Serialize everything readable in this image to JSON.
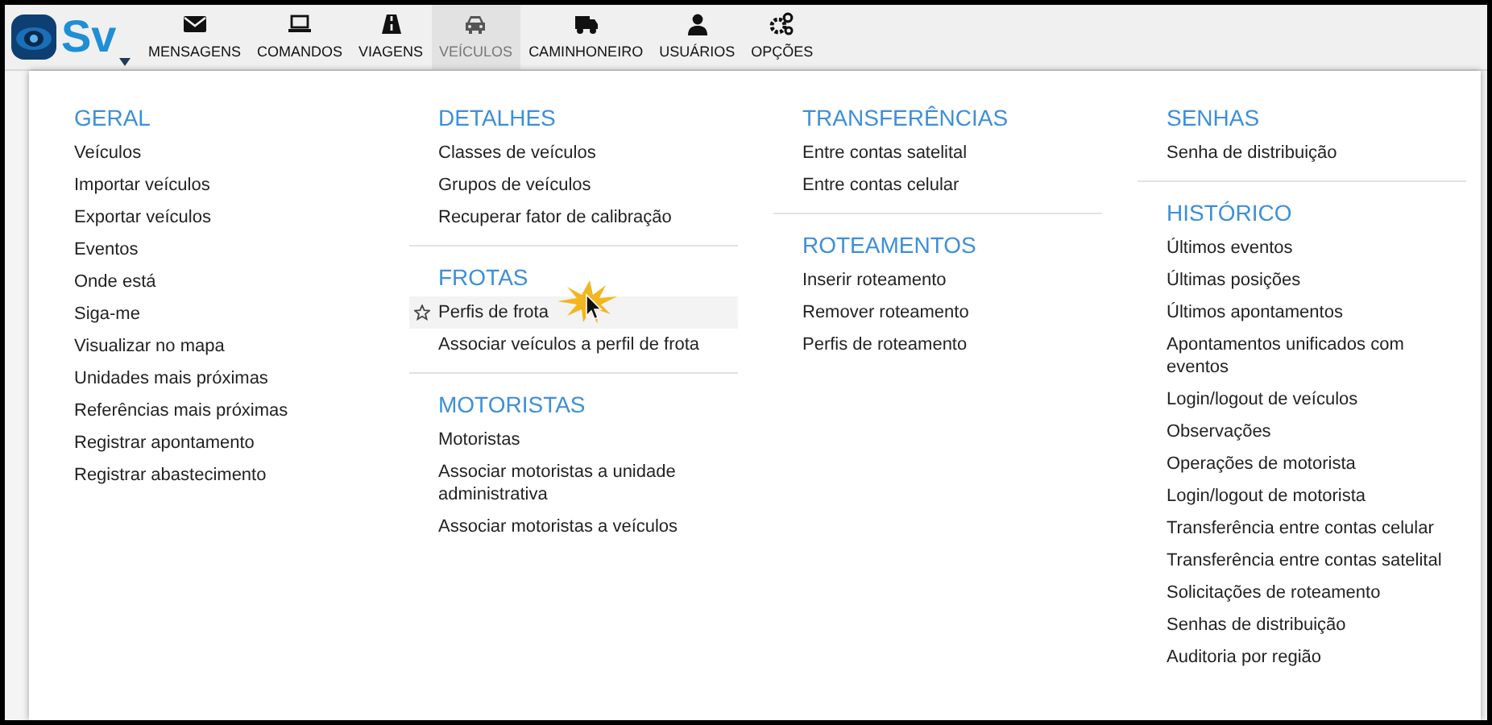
{
  "logo": {
    "text": "Sv"
  },
  "nav": [
    {
      "kind": "envelope",
      "label": "MENSAGENS",
      "selected": false
    },
    {
      "kind": "laptop",
      "label": "COMANDOS",
      "selected": false
    },
    {
      "kind": "road",
      "label": "VIAGENS",
      "selected": false
    },
    {
      "kind": "car",
      "label": "VEÍCULOS",
      "selected": true
    },
    {
      "kind": "truck",
      "label": "CAMINHONEIRO",
      "selected": false
    },
    {
      "kind": "user",
      "label": "USUÁRIOS",
      "selected": false
    },
    {
      "kind": "gears",
      "label": "OPÇÕES",
      "selected": false
    }
  ],
  "menu_columns": [
    [
      {
        "heading": "GERAL",
        "items": [
          {
            "label": "Veículos",
            "highlighted": false
          },
          {
            "label": "Importar veículos",
            "highlighted": false
          },
          {
            "label": "Exportar veículos",
            "highlighted": false
          },
          {
            "label": "Eventos",
            "highlighted": false
          },
          {
            "label": "Onde está",
            "highlighted": false
          },
          {
            "label": "Siga-me",
            "highlighted": false
          },
          {
            "label": "Visualizar no mapa",
            "highlighted": false
          },
          {
            "label": "Unidades mais próximas",
            "highlighted": false
          },
          {
            "label": "Referências mais próximas",
            "highlighted": false
          },
          {
            "label": "Registrar apontamento",
            "highlighted": false
          },
          {
            "label": "Registrar abastecimento",
            "highlighted": false
          }
        ]
      }
    ],
    [
      {
        "heading": "DETALHES",
        "items": [
          {
            "label": "Classes de veículos",
            "highlighted": false
          },
          {
            "label": "Grupos de veículos",
            "highlighted": false
          },
          {
            "label": "Recuperar fator de calibração",
            "highlighted": false
          }
        ]
      },
      {
        "heading": "FROTAS",
        "items": [
          {
            "label": "Perfis de frota",
            "highlighted": true
          },
          {
            "label": "Associar veículos a perfil de frota",
            "highlighted": false
          }
        ]
      },
      {
        "heading": "MOTORISTAS",
        "items": [
          {
            "label": "Motoristas",
            "highlighted": false
          },
          {
            "label": "Associar motoristas a unidade administrativa",
            "highlighted": false
          },
          {
            "label": "Associar motoristas a veículos",
            "highlighted": false
          }
        ]
      }
    ],
    [
      {
        "heading": "TRANSFERÊNCIAS",
        "items": [
          {
            "label": "Entre contas satelital",
            "highlighted": false
          },
          {
            "label": "Entre contas celular",
            "highlighted": false
          }
        ]
      },
      {
        "heading": "ROTEAMENTOS",
        "items": [
          {
            "label": "Inserir roteamento",
            "highlighted": false
          },
          {
            "label": "Remover roteamento",
            "highlighted": false
          },
          {
            "label": "Perfis de roteamento",
            "highlighted": false
          }
        ]
      }
    ],
    [
      {
        "heading": "SENHAS",
        "items": [
          {
            "label": "Senha de distribuição",
            "highlighted": false
          }
        ]
      },
      {
        "heading": "HISTÓRICO",
        "items": [
          {
            "label": "Últimos eventos",
            "highlighted": false
          },
          {
            "label": "Últimas posições",
            "highlighted": false
          },
          {
            "label": "Últimos apontamentos",
            "highlighted": false
          },
          {
            "label": "Apontamentos unificados com eventos",
            "highlighted": false
          },
          {
            "label": "Login/logout de veículos",
            "highlighted": false
          },
          {
            "label": "Observações",
            "highlighted": false
          },
          {
            "label": "Operações de motorista",
            "highlighted": false
          },
          {
            "label": "Login/logout de motorista",
            "highlighted": false
          },
          {
            "label": "Transferência entre contas celular",
            "highlighted": false
          },
          {
            "label": "Transferência entre contas satelital",
            "highlighted": false
          },
          {
            "label": "Solicitações de roteamento",
            "highlighted": false
          },
          {
            "label": "Senhas de distribuição",
            "highlighted": false
          },
          {
            "label": "Auditoria por região",
            "highlighted": false
          }
        ]
      }
    ]
  ]
}
